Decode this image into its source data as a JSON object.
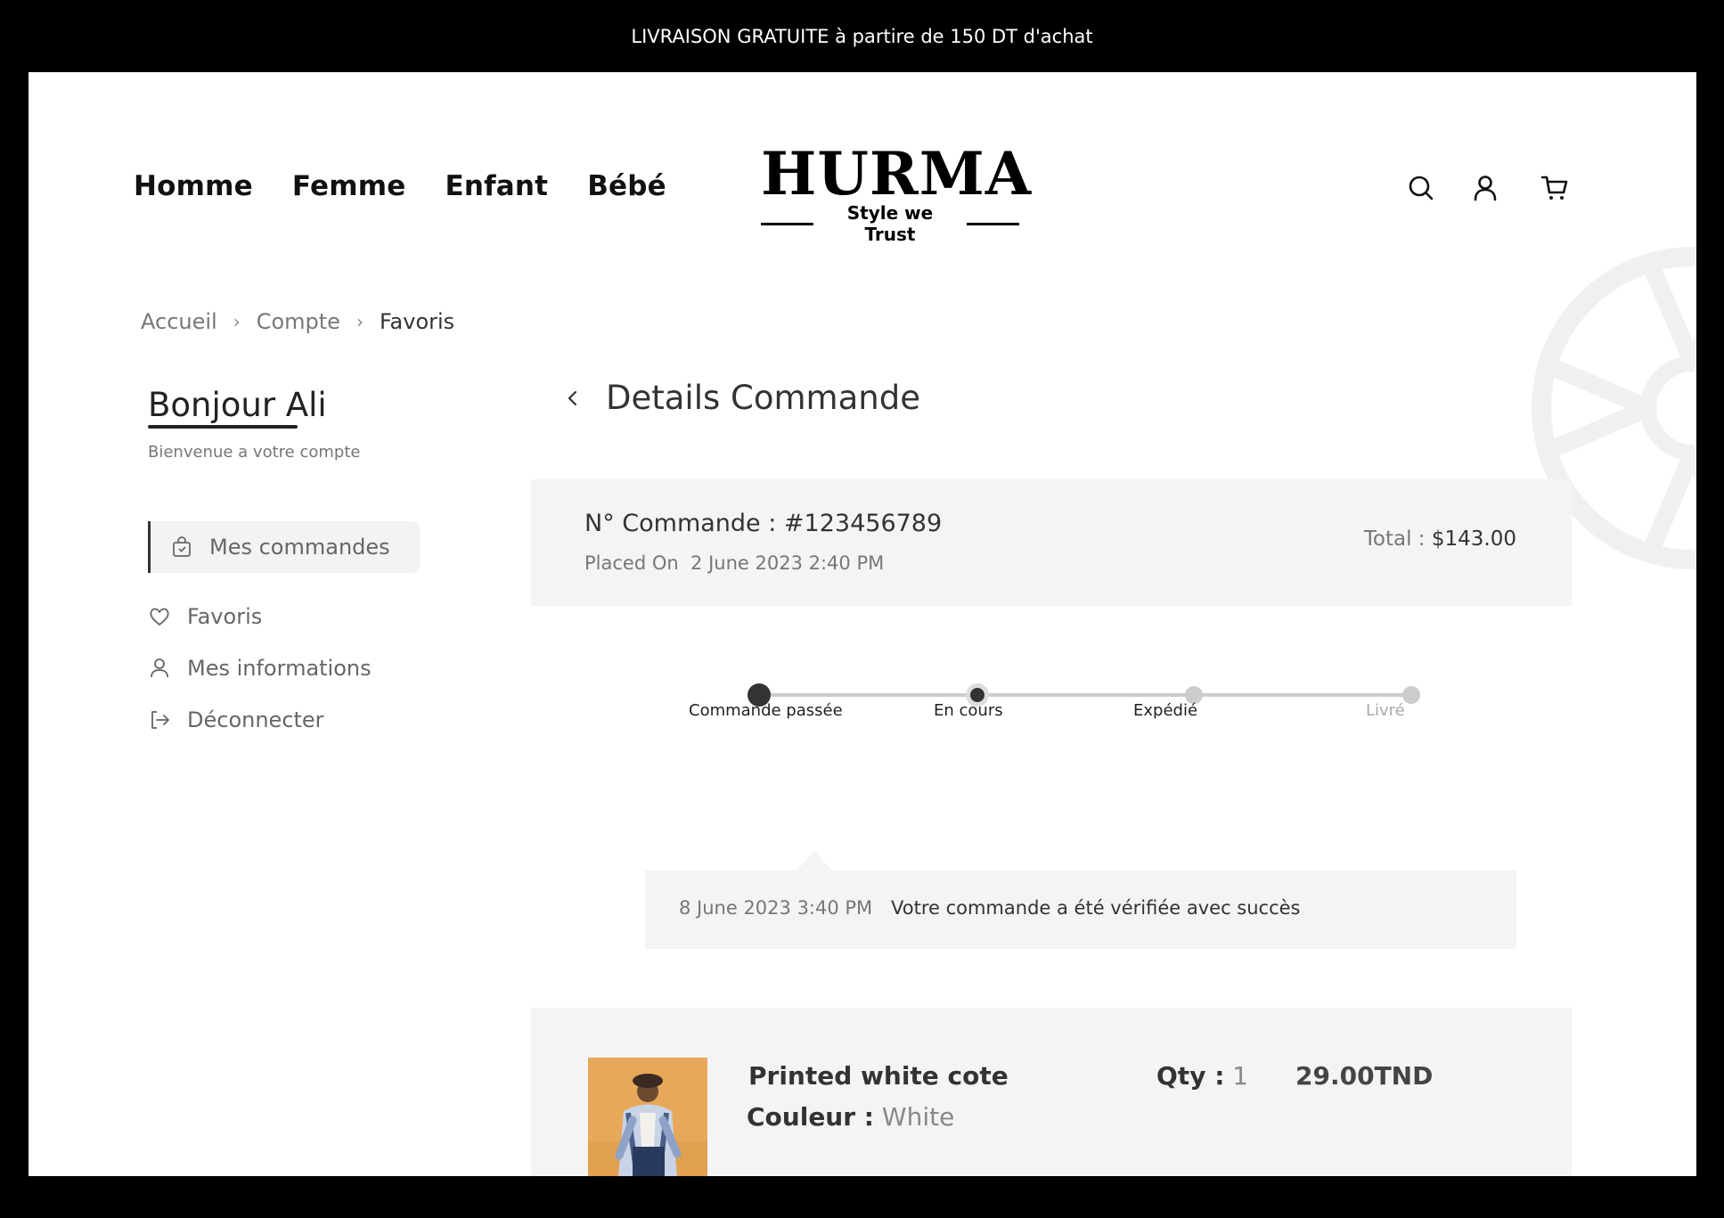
{
  "announcement": "LIVRAISON GRATUITE à partire de 150 DT d'achat",
  "nav": {
    "items": [
      {
        "label": "Homme"
      },
      {
        "label": "Femme"
      },
      {
        "label": "Enfant"
      },
      {
        "label": "Bébé"
      }
    ]
  },
  "logo": {
    "name": "HURMA",
    "tagline": "Style we Trust"
  },
  "header_icons": [
    "search-icon",
    "user-icon",
    "cart-icon"
  ],
  "breadcrumb": {
    "items": [
      "Accueil",
      "Compte",
      "Favoris"
    ]
  },
  "sidebar": {
    "greeting": "Bonjour Ali",
    "welcome": "Bienvenue a votre compte",
    "items": [
      {
        "label": "Mes commandes",
        "icon": "shopping-bag-icon",
        "active": true
      },
      {
        "label": "Favoris",
        "icon": "heart-icon"
      },
      {
        "label": "Mes informations",
        "icon": "user-icon"
      },
      {
        "label": "Déconnecter",
        "icon": "logout-icon"
      }
    ]
  },
  "page": {
    "title": "Details Commande"
  },
  "order": {
    "number_label": "N° Commande : #123456789",
    "placed_label": "Placed On",
    "placed_date": "2 June 2023 2:40 PM",
    "total_label": "Total :",
    "total_value": "$143.00"
  },
  "tracking": {
    "steps": [
      {
        "label": "Commande passée",
        "state": "done"
      },
      {
        "label": "En cours",
        "state": "current"
      },
      {
        "label": "Expédié",
        "state": "pending"
      },
      {
        "label": "Livré",
        "state": "pending"
      }
    ],
    "status_date": "8 June 2023 3:40 PM",
    "status_message": "Votre commande a été vérifiée avec succès"
  },
  "items": [
    {
      "name": "Printed white cote",
      "color_label": "Couleur :",
      "color_value": "White",
      "qty_label": "Qty :",
      "qty_value": "1",
      "price": "29.00TND"
    }
  ],
  "colors": {
    "accent": "#333333",
    "card_bg": "#f4f4f4",
    "track_line": "#cccccc"
  }
}
